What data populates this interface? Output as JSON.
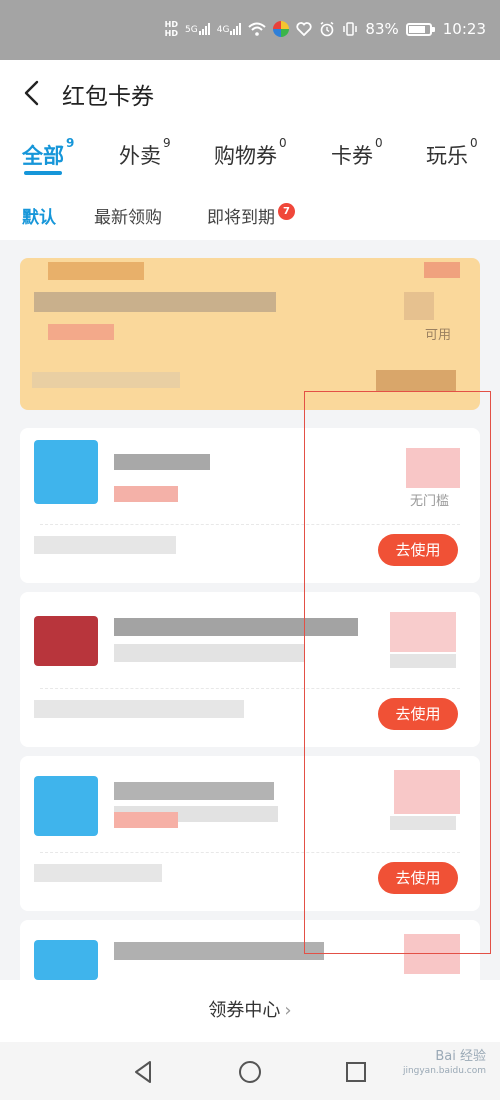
{
  "status_bar": {
    "hd1": "HD",
    "hd2": "HD",
    "net1": "5G",
    "net2": "4G",
    "battery": "83%",
    "time": "10:23"
  },
  "header": {
    "title": "红包卡券",
    "back_icon": "chevron-left-icon"
  },
  "tabs": [
    {
      "label": "全部",
      "count": "9",
      "active": true
    },
    {
      "label": "外卖",
      "count": "9",
      "active": false
    },
    {
      "label": "购物券",
      "count": "0",
      "active": false
    },
    {
      "label": "卡券",
      "count": "0",
      "active": false
    },
    {
      "label": "玩乐",
      "count": "0",
      "active": false
    }
  ],
  "filters": [
    {
      "label": "默认",
      "active": true
    },
    {
      "label": "最新领购",
      "active": false
    },
    {
      "label": "即将到期",
      "active": false,
      "badge": "7"
    }
  ],
  "cards": {
    "card1": {
      "suffix": "可用"
    },
    "card2": {
      "condition": "无门槛",
      "use_label": "去使用"
    },
    "card3": {
      "use_label": "去使用"
    },
    "card4": {
      "use_label": "去使用"
    }
  },
  "bottom": {
    "label": "领券中心",
    "chevron": "›"
  },
  "watermark": {
    "brand": "Bai 经验",
    "url": "jingyan.baidu.com"
  },
  "colors": {
    "accent_blue": "#1696d9",
    "use_button": "#f05136",
    "badge_red": "#f0473a",
    "gold_card": "#fad89b",
    "annotation_red": "#e35046"
  }
}
